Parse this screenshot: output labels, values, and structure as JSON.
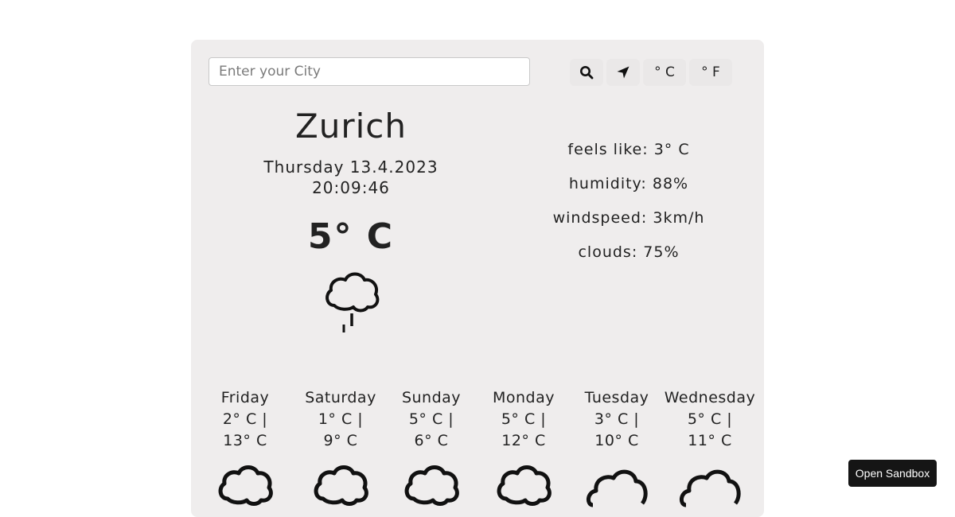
{
  "search": {
    "placeholder": "Enter your City",
    "value": ""
  },
  "toolbar": {
    "search_icon": "search-icon",
    "location_icon": "location-arrow-icon",
    "celsius_label": "° C",
    "fahrenheit_label": "° F"
  },
  "current": {
    "city": "Zurich",
    "date": "Thursday 13.4.2023",
    "time": "20:09:46",
    "temperature": "5° C",
    "icon": "cloud-rain-icon"
  },
  "details": {
    "feels_like": "feels like: 3° C",
    "humidity": "humidity: 88%",
    "windspeed": "windspeed: 3km/h",
    "clouds": "clouds: 75%"
  },
  "forecast": [
    {
      "day": "Friday",
      "min": "2° C |",
      "max": "13° C",
      "icon": "cloud-rain-icon"
    },
    {
      "day": "Saturday",
      "min": "1° C |",
      "max": "9° C",
      "icon": "cloud-rain-icon"
    },
    {
      "day": "Sunday",
      "min": "5° C |",
      "max": "6° C",
      "icon": "cloud-rain-icon"
    },
    {
      "day": "Monday",
      "min": "5° C |",
      "max": "12° C",
      "icon": "cloud-rain-icon"
    },
    {
      "day": "Tuesday",
      "min": "3° C |",
      "max": "10° C",
      "icon": "cloud-icon"
    },
    {
      "day": "Wednesday",
      "min": "5° C |",
      "max": "11° C",
      "icon": "cloud-icon"
    }
  ],
  "sandbox": {
    "label": "Open Sandbox"
  },
  "colors": {
    "card_bg": "#efeded",
    "button_bg": "#eae8e8",
    "text": "#222222",
    "sandbox_bg": "#151515"
  }
}
